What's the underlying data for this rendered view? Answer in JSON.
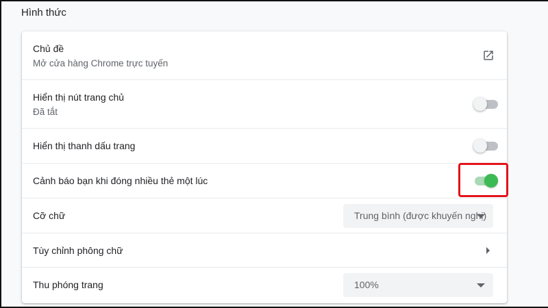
{
  "section_title": "Hình thức",
  "rows": {
    "theme": {
      "label": "Chủ đề",
      "sub": "Mở cửa hàng Chrome trực tuyến"
    },
    "home_button": {
      "label": "Hiển thị nút trang chủ",
      "sub": "Đã tắt",
      "enabled": false
    },
    "bookmarks_bar": {
      "label": "Hiển thị thanh dấu trang",
      "enabled": false
    },
    "warn_close_tabs": {
      "label": "Cảnh báo bạn khi đóng nhiều thẻ một lúc",
      "enabled": true
    },
    "font_size": {
      "label": "Cỡ chữ",
      "value": "Trung bình (được khuyến nghị)"
    },
    "customize_fonts": {
      "label": "Tùy chỉnh phông chữ"
    },
    "page_zoom": {
      "label": "Thu phóng trang",
      "value": "100%"
    }
  },
  "colors": {
    "toggle_on": "#3cba54",
    "highlight": "#e4121b"
  }
}
